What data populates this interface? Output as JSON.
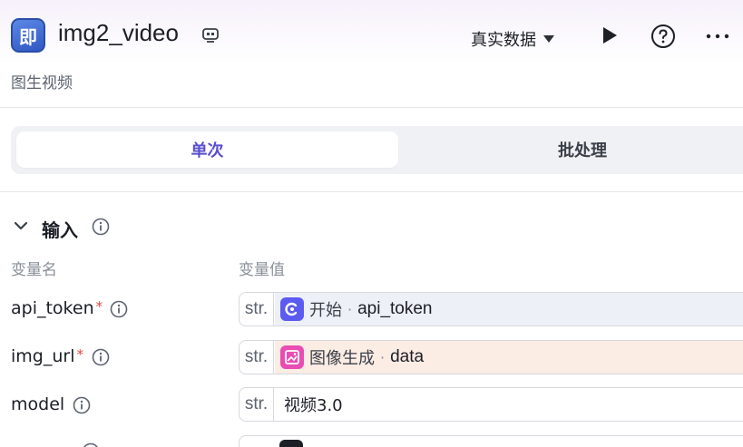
{
  "header": {
    "app_icon_char": "即",
    "title": "img2_video",
    "subtitle": "图生视频",
    "data_mode": "真实数据"
  },
  "tabs": [
    {
      "label": "单次",
      "active": true
    },
    {
      "label": "批处理",
      "active": false
    }
  ],
  "input_section": {
    "title": "输入",
    "col_name": "变量名",
    "col_value": "变量值",
    "rows": [
      {
        "name": "api_token",
        "required": "*",
        "type": "str.",
        "node": "开始",
        "sep": "·",
        "var": "api_token"
      },
      {
        "name": "img_url",
        "required": "*",
        "type": "str.",
        "node": "图像生成",
        "sep": "·",
        "var": "data"
      },
      {
        "name": "model",
        "type": "str.",
        "value": "视频3.0"
      }
    ]
  },
  "colors": {
    "accent": "#5a4fcf",
    "start_node": "#5b5bf0",
    "image_node": "#e94db3",
    "ref_bg_start": "#eef0f7",
    "ref_bg_image": "#fbece4",
    "required": "#e3463c"
  },
  "icons": {
    "app": "app-logo-icon",
    "template": "template-icon",
    "run": "play-icon",
    "help": "help-circle-icon",
    "more": "more-dots-icon"
  }
}
